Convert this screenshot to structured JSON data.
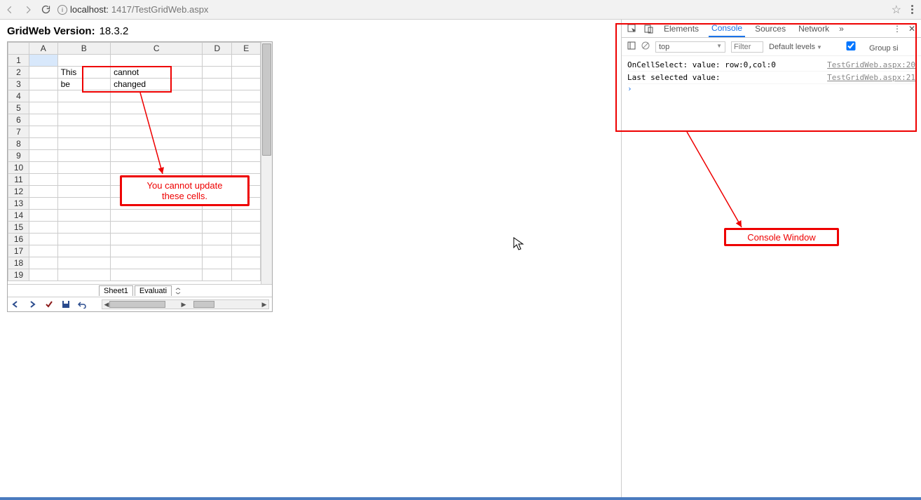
{
  "browser": {
    "url_host": "localhost:",
    "url_port_path": "1417/TestGridWeb.aspx"
  },
  "heading": {
    "label": "GridWeb Version:",
    "version": "18.3.2"
  },
  "grid": {
    "columns": [
      "A",
      "B",
      "C",
      "D",
      "E"
    ],
    "rows": 19,
    "cells": {
      "B2": "This",
      "C2": "cannot",
      "B3": "be",
      "C3": "changed"
    },
    "tabs": [
      "Sheet1",
      "Evaluati"
    ]
  },
  "annotations": {
    "cells_callout": "You cannot update\nthese cells.",
    "console_callout": "Console  Window"
  },
  "devtools": {
    "tabs": [
      "Elements",
      "Console",
      "Sources",
      "Network"
    ],
    "context": "top",
    "filter_placeholder": "Filter",
    "levels": "Default levels",
    "group": "Group si",
    "log": [
      {
        "msg": "OnCellSelect: value: row:0,col:0",
        "src": "TestGridWeb.aspx:20"
      },
      {
        "msg": "Last selected value:",
        "src": "TestGridWeb.aspx:21"
      }
    ]
  }
}
